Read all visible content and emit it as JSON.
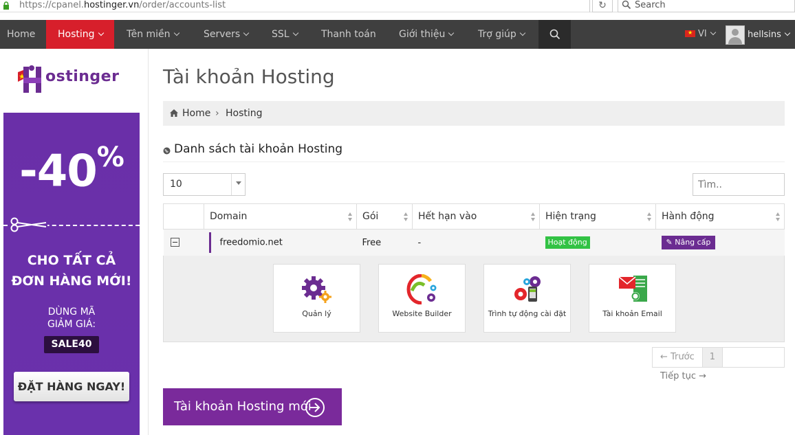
{
  "browser": {
    "url_prefix": "https://cpanel.",
    "url_domain": "hostinger.vn",
    "url_path": "/order/accounts-list",
    "search_placeholder": "Search"
  },
  "nav": {
    "items": [
      {
        "label": "Home"
      },
      {
        "label": "Hosting"
      },
      {
        "label": "Tên miền"
      },
      {
        "label": "Servers"
      },
      {
        "label": "SSL"
      },
      {
        "label": "Thanh toán"
      },
      {
        "label": "Giới thiệu"
      },
      {
        "label": "Trợ giúp"
      }
    ],
    "language": "VI",
    "username": "hellsins"
  },
  "sidebar": {
    "logo_text": "ostinger",
    "promo": {
      "discount": "-40",
      "discount_suffix": "%",
      "headline_1": "CHO TẤT CẢ",
      "headline_2": "ĐƠN HÀNG MỚI!",
      "code_label_1": "DÙNG MÃ",
      "code_label_2": "GIẢM GIÁ:",
      "code": "SALE40",
      "cta": "ĐẶT HÀNG NGAY!"
    }
  },
  "main": {
    "title": "Tài khoản Hosting",
    "breadcrumb": {
      "home": "Home",
      "current": "Hosting"
    },
    "section_title": "Danh sách tài khoản Hosting",
    "page_size": "10",
    "filter_placeholder": "Tìm..",
    "table": {
      "headers": [
        "Domain",
        "Gói",
        "Hết hạn vào",
        "Hiện trạng",
        "Hành động"
      ],
      "rows": [
        {
          "domain": "freedomio.net",
          "plan": "Free",
          "expires": "-",
          "status": "Hoạt động",
          "action": "Nâng cấp"
        }
      ]
    },
    "tiles": [
      {
        "label": "Quản lý",
        "icon": "gear-icon"
      },
      {
        "label": "Website Builder",
        "icon": "website-builder-icon"
      },
      {
        "label": "Trình tự động cài đặt",
        "icon": "auto-installer-icon"
      },
      {
        "label": "Tài khoản Email",
        "icon": "email-icon"
      }
    ],
    "pagination": {
      "prev": "← Trước",
      "current": "1",
      "next": "Tiếp tục →"
    },
    "new_account_button": "Tài khoản Hosting mới"
  },
  "colors": {
    "nav_bg": "#3f3f3f",
    "nav_active": "#d71f2b",
    "brand_purple": "#6b2c91",
    "status_green": "#32c244"
  }
}
